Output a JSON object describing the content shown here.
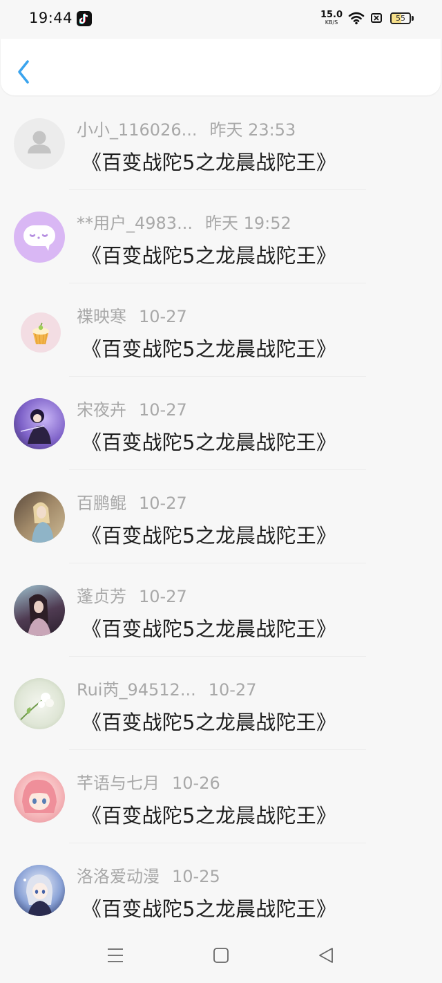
{
  "status_bar": {
    "time": "19:44",
    "speed_value": "15.0",
    "speed_unit": "KB/S",
    "battery": "55",
    "battery_level_percent": 55,
    "app_icon": "tiktok-icon",
    "wifi_icon": "wifi-icon",
    "sim_icon": "sim-off-icon"
  },
  "header": {
    "back_icon": "chevron-left-icon",
    "accent_color": "#3aa4ee"
  },
  "items": [
    {
      "name": "小小_116026...",
      "date": "昨天 23:53",
      "message": "《百变战陀5之龙晨战陀王》",
      "avatar": "default-user-avatar"
    },
    {
      "name": "**用户_4983...",
      "date": "昨天 19:52",
      "message": "《百变战陀5之龙晨战陀王》",
      "avatar": "chat-bubble-avatar"
    },
    {
      "name": "褋映寒",
      "date": "10-27",
      "message": "《百变战陀5之龙晨战陀王》",
      "avatar": "cupcake-avatar"
    },
    {
      "name": "宋夜卉",
      "date": "10-27",
      "message": "《百变战陀5之龙晨战陀王》",
      "avatar": "anime-purple-avatar"
    },
    {
      "name": "百鹏鲲",
      "date": "10-27",
      "message": "《百变战陀5之龙晨战陀王》",
      "avatar": "girl-photo-avatar"
    },
    {
      "name": "蓬贞芳",
      "date": "10-27",
      "message": "《百变战陀5之龙晨战陀王》",
      "avatar": "girl-dark-avatar"
    },
    {
      "name": "Rui芮_94512...",
      "date": "10-27",
      "message": "《百变战陀5之龙晨战陀王》",
      "avatar": "flower-avatar"
    },
    {
      "name": "芊语与七月",
      "date": "10-26",
      "message": "《百变战陀5之龙晨战陀王》",
      "avatar": "anime-pink-avatar"
    },
    {
      "name": "洛洛爱动漫",
      "date": "10-25",
      "message": "《百变战陀5之龙晨战陀王》",
      "avatar": "anime-blue-avatar"
    }
  ],
  "nav_bar": {
    "menu_icon": "menu-icon",
    "home_icon": "home-icon",
    "back_icon": "back-triangle-icon"
  }
}
